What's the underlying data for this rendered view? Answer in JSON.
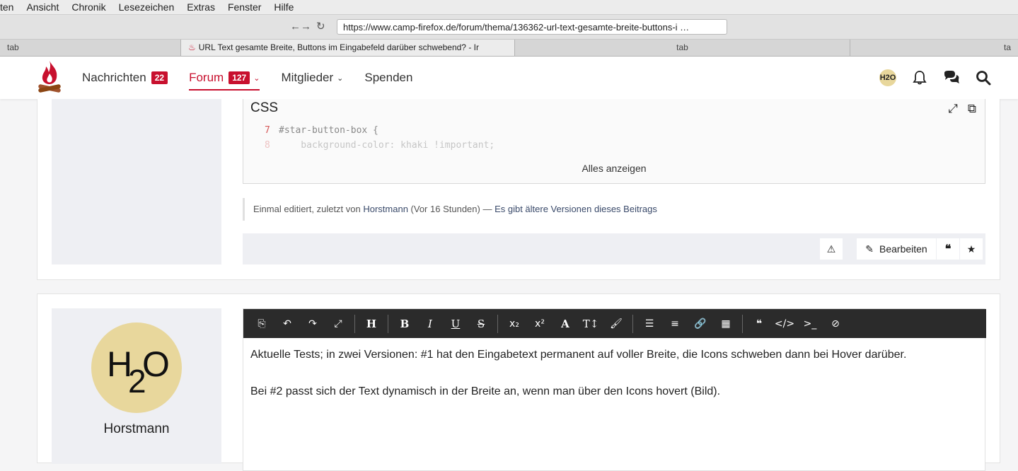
{
  "menubar": {
    "items": [
      "ten",
      "Ansicht",
      "Chronik",
      "Lesezeichen",
      "Extras",
      "Fenster",
      "Hilfe"
    ]
  },
  "toolbar": {
    "url": "https://www.camp-firefox.de/forum/thema/136362-url-text-gesamte-breite-buttons-i …"
  },
  "tabs": [
    {
      "label": "tab"
    },
    {
      "label": "URL Text gesamte Breite, Buttons im Eingabefeld darüber schwebend? - Ir"
    },
    {
      "label": "tab"
    },
    {
      "label": "ta"
    }
  ],
  "nav": {
    "items": [
      {
        "label": "Nachrichten",
        "badge": "22"
      },
      {
        "label": "Forum",
        "badge": "127"
      },
      {
        "label": "Mitglieder"
      },
      {
        "label": "Spenden"
      }
    ],
    "avatar_text": "H2O"
  },
  "post1": {
    "code_title": "CSS",
    "code_lines": [
      {
        "no": "7",
        "text": "#star-button-box {"
      },
      {
        "no": "8",
        "text": "    background-color: khaki !important;"
      }
    ],
    "show_all": "Alles anzeigen",
    "edit_prefix": "Einmal editiert, zuletzt von ",
    "edit_user": "Horstmann",
    "edit_time": " (Vor 16 Stunden) — ",
    "edit_link": "Es gibt ältere Versionen dieses Beitrags",
    "edit_label": "Bearbeiten"
  },
  "post2": {
    "username": "Horstmann",
    "paragraphs": [
      "Aktuelle Tests; in zwei Versionen: #1 hat den Eingabetext permanent auf voller Breite, die Icons schweben dann bei Hover darüber.",
      "Bei #2 passt sich der Text dynamisch in der Breite an, wenn man über den Icons hovert (Bild)."
    ]
  },
  "colors": {
    "accent": "#c8102e",
    "avatar": "#e8d79c",
    "editor_toolbar": "#2b2b2b"
  }
}
